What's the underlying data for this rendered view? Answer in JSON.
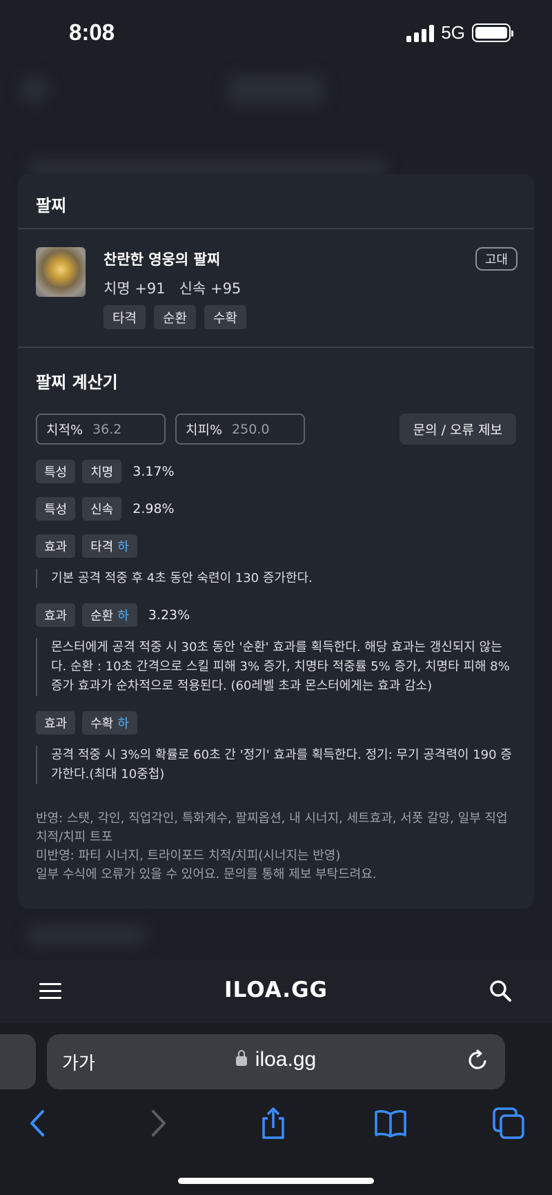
{
  "status": {
    "time": "8:08",
    "network": "5G"
  },
  "panel": {
    "title": "팔찌",
    "item": {
      "name": "찬란한 영웅의 팔찌",
      "stats": "치명 +91   신속 +95",
      "grade": "고대",
      "tags": [
        "타격",
        "순환",
        "수확"
      ]
    },
    "calculator": {
      "title": "팔찌 계산기",
      "crit_label": "치적%",
      "crit_value": "36.2",
      "critdmg_label": "치피%",
      "critdmg_value": "250.0",
      "report_button": "문의 / 오류 제보",
      "results": [
        {
          "type": "특성",
          "name": "치명",
          "level": "",
          "value": "3.17%",
          "desc": ""
        },
        {
          "type": "특성",
          "name": "신속",
          "level": "",
          "value": "2.98%",
          "desc": ""
        },
        {
          "type": "효과",
          "name": "타격",
          "level": "하",
          "value": "",
          "desc": "기본 공격 적중 후 4초 동안 숙련이 130 증가한다."
        },
        {
          "type": "효과",
          "name": "순환",
          "level": "하",
          "value": "3.23%",
          "desc": "몬스터에게 공격 적중 시 30초 동안 '순환' 효과를 획득한다. 해당 효과는 갱신되지 않는다. 순환 : 10초 간격으로 스킬 피해 3% 증가, 치명타 적중률 5% 증가, 치명타 피해 8% 증가 효과가 순차적으로 적용된다. (60레벨 초과 몬스터에게는 효과 감소)"
        },
        {
          "type": "효과",
          "name": "수확",
          "level": "하",
          "value": "",
          "desc": "공격 적중 시 3%의 확률로 60초 간 '정기' 효과를 획득한다. 정기: 무기 공격력이 190 증가한다.(최대 10중첩)"
        }
      ],
      "notes": [
        "반영: 스탯, 각인, 직업각인, 특화계수, 팔찌옵션, 내 시너지, 세트효과, 서폿 갈망, 일부 직업 치적/치피 트포",
        "미반영: 파티 시너지, 트라이포드 치적/치피(시너지는 반영)",
        "일부 수식에 오류가 있을 수 있어요. 문의를 통해 제보 부탁드려요."
      ]
    }
  },
  "site_nav": {
    "logo": "ILOA.GG"
  },
  "safari": {
    "aa_label": "가가",
    "url": "iloa.gg"
  }
}
